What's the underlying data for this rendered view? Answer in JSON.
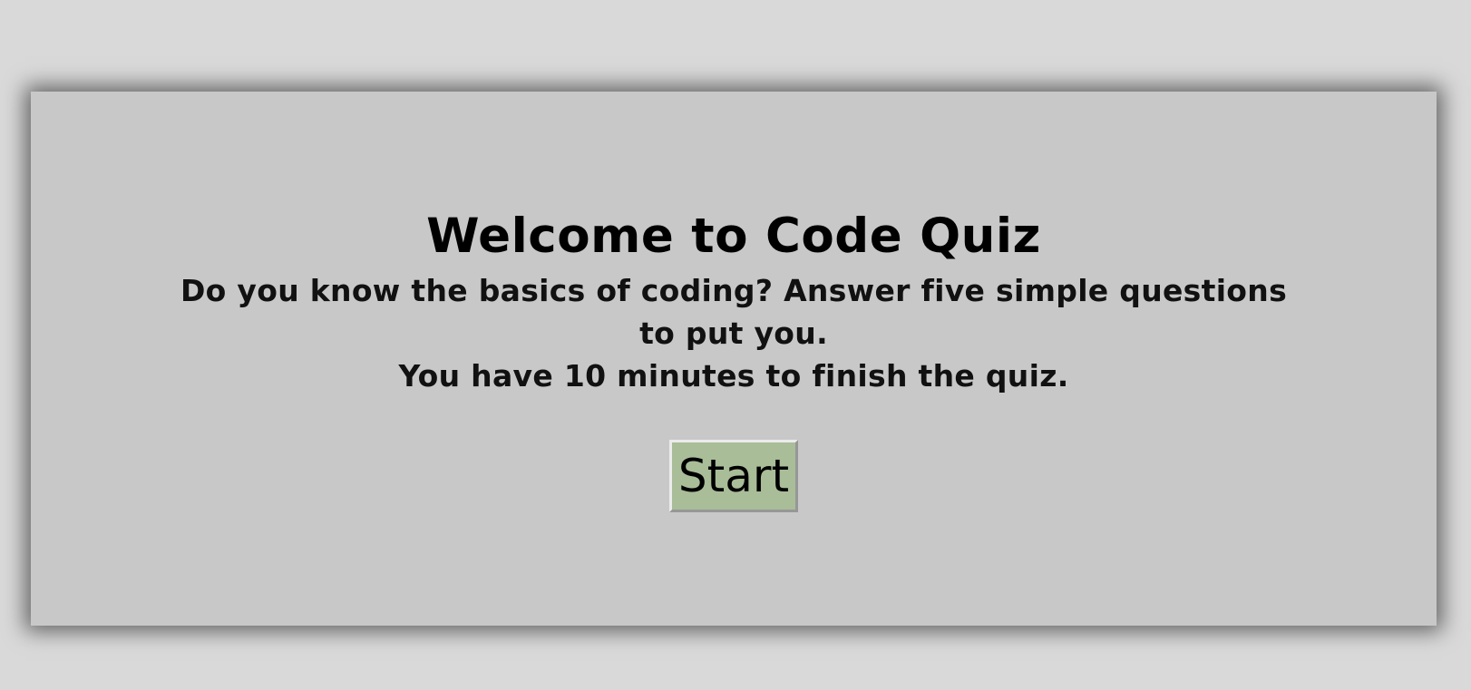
{
  "quiz": {
    "title": "Welcome to Code Quiz",
    "intro_line_1": "Do you know the basics of coding? Answer five simple questions to put you.",
    "intro_line_2": "You have 10 minutes to finish the quiz.",
    "start_label": "Start"
  },
  "colors": {
    "page_background": "#d9d9d9",
    "card_background": "#c8c8c8",
    "start_button": "#a8bd98"
  }
}
